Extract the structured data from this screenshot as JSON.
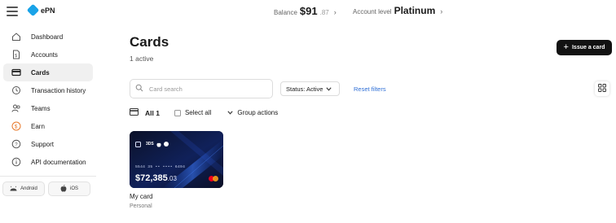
{
  "app": {
    "logo_text": "ePN",
    "brand_color": "#1aa3e8"
  },
  "header": {
    "balance_label": "Balance",
    "balance_amount": "$91",
    "balance_cents": ".87",
    "account_level_label": "Account level",
    "account_level_value": "Platinum"
  },
  "sidebar": {
    "items": [
      {
        "label": "Dashboard",
        "icon": "home-icon"
      },
      {
        "label": "Accounts",
        "icon": "document-icon"
      },
      {
        "label": "Cards",
        "icon": "card-icon",
        "active": true
      },
      {
        "label": "Transaction history",
        "icon": "history-icon"
      },
      {
        "label": "Teams",
        "icon": "users-icon"
      },
      {
        "label": "Earn",
        "icon": "dollar-icon"
      },
      {
        "label": "Support",
        "icon": "help-icon"
      },
      {
        "label": "API documentation",
        "icon": "info-icon"
      }
    ],
    "apps": {
      "android_label": "Android",
      "ios_label": "iOS"
    }
  },
  "main": {
    "title": "Cards",
    "subtitle": "1 active",
    "issue_button_label": "Issue a card",
    "search_placeholder": "Card search",
    "status_filter": "Status: Active",
    "reset_filters": "Reset filters",
    "all_label": "All 1",
    "select_all_label": "Select all",
    "group_actions_label": "Group actions"
  },
  "cards": [
    {
      "tag": "3DS",
      "number": "5544 35 •• •••• 6494",
      "amount": "$72,385",
      "amount_decimal": ".03",
      "name": "My card",
      "type": "Personal"
    }
  ],
  "colors": {
    "link": "#2f6fd6",
    "primary_button": "#121212",
    "card_background": "#0a1022"
  }
}
